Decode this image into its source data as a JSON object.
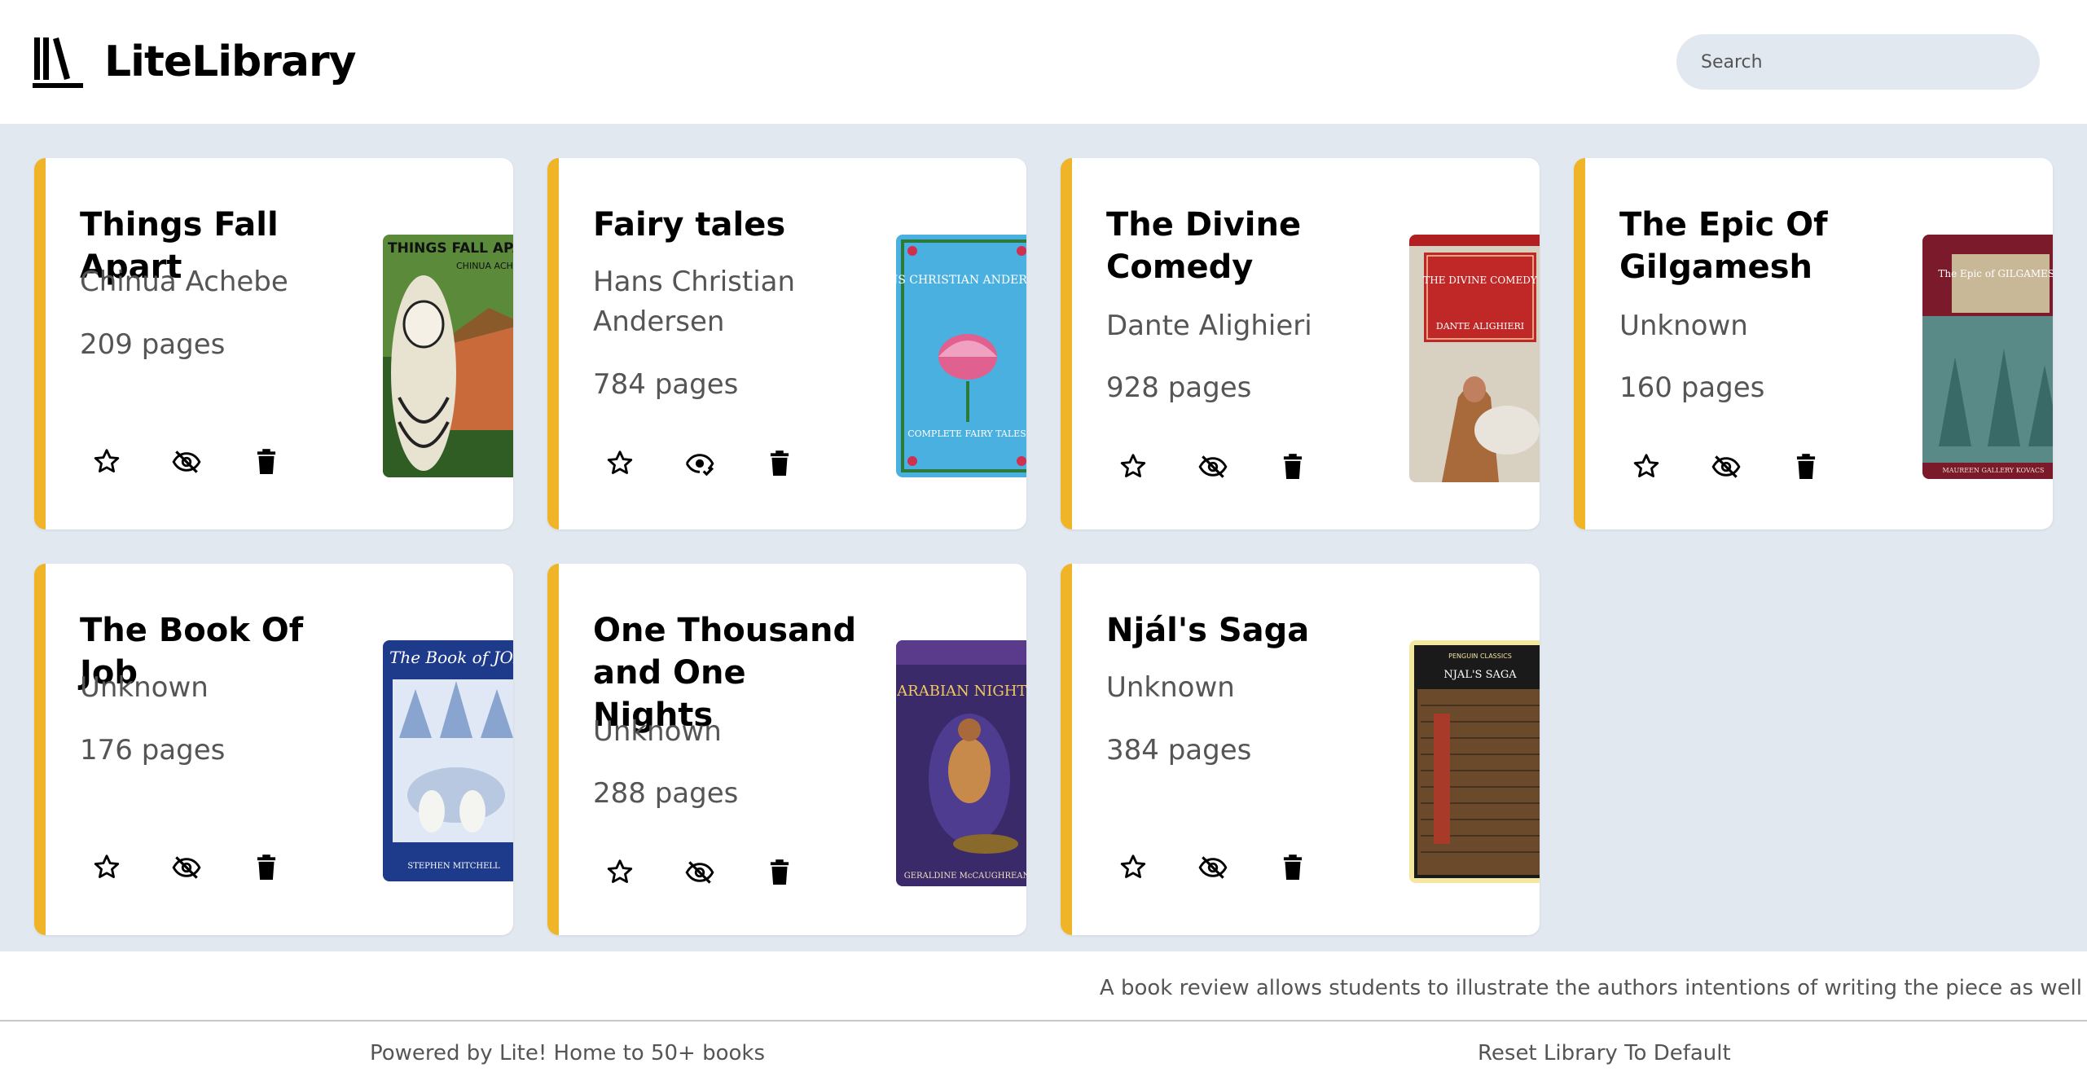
{
  "app": {
    "name": "LiteLibrary",
    "search_placeholder": "Search"
  },
  "books": [
    {
      "title": "Things Fall Apart",
      "author": "Chinua Achebe",
      "pages": "209 pages",
      "cover_text": "THINGS FALL APART",
      "cover_sub": "CHINUA ACHEBE",
      "read": false
    },
    {
      "title": "Fairy tales",
      "author": "Hans Christian Andersen",
      "pages": "784 pages",
      "cover_text": "HANS CHRISTIAN ANDERSEN'S",
      "cover_sub": "COMPLETE FAIRY TALES",
      "read": true
    },
    {
      "title": "The Divine Comedy",
      "author": "Dante Alighieri",
      "pages": "928 pages",
      "cover_text": "THE DIVINE COMEDY",
      "cover_sub": "DANTE ALIGHIERI",
      "read": false
    },
    {
      "title": "The Epic Of Gilgamesh",
      "author": "Unknown",
      "pages": "160 pages",
      "cover_text": "The Epic of GILGAMESH",
      "cover_sub": "MAUREEN GALLERY KOVACS",
      "read": false
    },
    {
      "title": "The Book Of Job",
      "author": "Unknown",
      "pages": "176 pages",
      "cover_text": "The Book of JOB",
      "cover_sub": "STEPHEN MITCHELL",
      "read": false
    },
    {
      "title": "One Thousand and One Nights",
      "author": "Unknown",
      "pages": "288 pages",
      "cover_text": "ARABIAN NIGHTS",
      "cover_sub": "GERALDINE McCAUGHREAN",
      "read": false
    },
    {
      "title": "Njál's Saga",
      "author": "Unknown",
      "pages": "384 pages",
      "cover_text": "NJAL'S SAGA",
      "cover_sub": "PENGUIN CLASSICS",
      "read": false
    }
  ],
  "banner": {
    "text": "A book review allows students to illustrate the authors intentions of writing the piece as well"
  },
  "footer": {
    "powered": "Powered by Lite! Home to 50+ books",
    "reset": "Reset Library To Default"
  },
  "colors": {
    "accent": "#f0b429",
    "background": "#e2e8f0"
  }
}
